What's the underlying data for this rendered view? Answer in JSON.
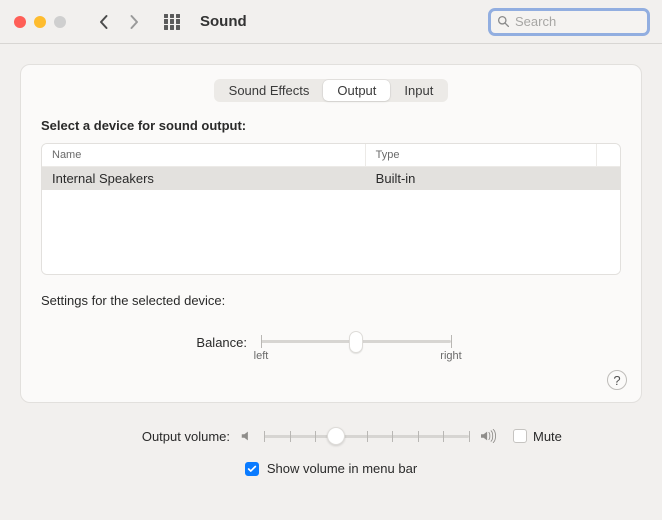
{
  "window": {
    "title": "Sound"
  },
  "search": {
    "placeholder": "Search"
  },
  "tabs": {
    "effects": "Sound Effects",
    "output": "Output",
    "input": "Input",
    "active": "output"
  },
  "section": {
    "select_output": "Select a device for sound output:",
    "headers": {
      "name": "Name",
      "type": "Type"
    },
    "devices": [
      {
        "name": "Internal Speakers",
        "type": "Built-in",
        "selected": true
      }
    ]
  },
  "settings": {
    "heading": "Settings for the selected device:",
    "balance_label": "Balance:",
    "balance_left": "left",
    "balance_right": "right",
    "balance_value": 0.5
  },
  "footer": {
    "output_label": "Output volume:",
    "output_value": 0.35,
    "mute_label": "Mute",
    "mute_checked": false,
    "menubar_label": "Show volume in menu bar",
    "menubar_checked": true
  },
  "help": {
    "glyph": "?"
  }
}
